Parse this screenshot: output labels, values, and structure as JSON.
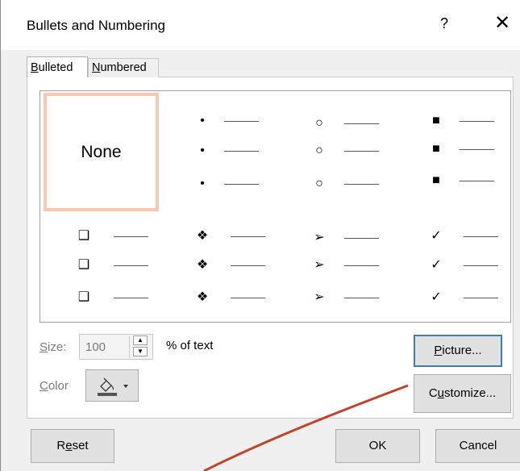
{
  "dialog": {
    "title": "Bullets and Numbering",
    "help_label": "?",
    "close_label": "✕"
  },
  "tabs": [
    {
      "label_first": "B",
      "label_rest": "ulleted",
      "active": true
    },
    {
      "label_first": "N",
      "label_rest": "umbered",
      "active": false
    }
  ],
  "gallery": {
    "none_label": "None",
    "styles": [
      {
        "name": "filled-round-bullet",
        "symbol": "•"
      },
      {
        "name": "hollow-round-bullet",
        "symbol": "○"
      },
      {
        "name": "filled-square-bullet",
        "symbol": "■"
      },
      {
        "name": "hollow-square-bullet",
        "symbol": "❑"
      },
      {
        "name": "diamond-star-bullet",
        "symbol": "❖"
      },
      {
        "name": "arrowhead-bullet",
        "symbol": "➢"
      },
      {
        "name": "checkmark-bullet",
        "symbol": "✓"
      }
    ]
  },
  "size": {
    "label_first": "S",
    "label_rest": "ize:",
    "value": "100",
    "unit_label": "% of text"
  },
  "color": {
    "label_first": "C",
    "label_rest": "olor"
  },
  "buttons": {
    "picture_first": "P",
    "picture_rest": "icture...",
    "customize_pre": "C",
    "customize_u": "u",
    "customize_rest": "stomize...",
    "reset_pre": "R",
    "reset_u": "e",
    "reset_rest": "set",
    "ok": "OK",
    "cancel": "Cancel"
  },
  "colors": {
    "selection_border": "#f8c9b0",
    "focus_border": "#3c7fb1",
    "annotation_arrow": "#c0442a"
  }
}
